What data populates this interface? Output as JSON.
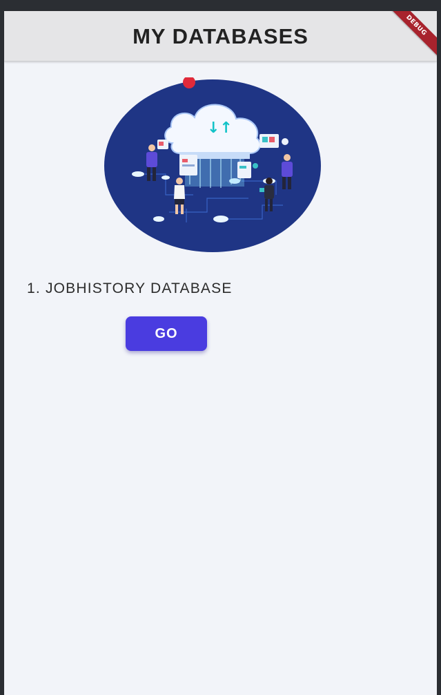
{
  "app_bar": {
    "title": "MY DATABASES",
    "debug_banner": "DEBUG"
  },
  "hero": {
    "icon": "cloud-database-illustration-icon",
    "transfer_symbol": "↓↑"
  },
  "databases": [
    {
      "label": "1. JOBHISTORY DATABASE",
      "button_label": "GO"
    }
  ],
  "colors": {
    "app_bar": "#e5e5e7",
    "background": "#f2f4f9",
    "button": "#4a3ce0",
    "hero_circle": "#1f3585",
    "debug_banner": "#a8232d",
    "accent_dot": "#e02a3a"
  }
}
